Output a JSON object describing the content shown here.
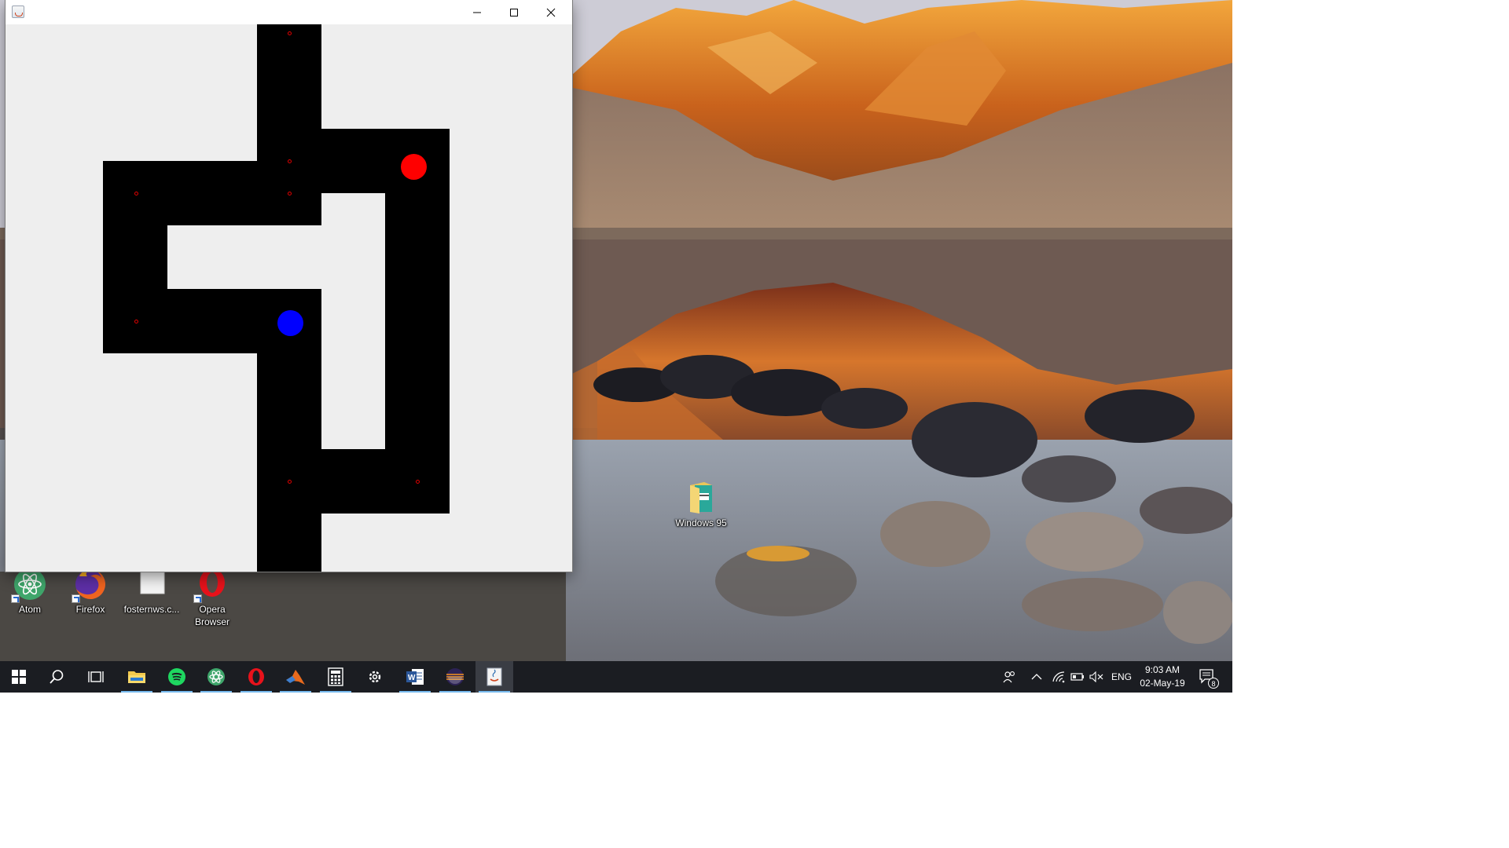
{
  "window": {
    "title": "",
    "icon": "java-icon",
    "controls": {
      "minimize": "minimize-icon",
      "maximize": "maximize-icon",
      "close": "close-icon"
    }
  },
  "maze": {
    "wall_color": "#000000",
    "floor_color": "#eeeeee",
    "waypoint_color": "#e00000",
    "player_color": "#0000ff",
    "enemy_color": "#ff0000"
  },
  "desktop_icons": [
    {
      "label": "Atom",
      "icon": "atom-icon"
    },
    {
      "label": "Firefox",
      "icon": "firefox-icon"
    },
    {
      "label": "fosternws.c...",
      "icon": "file-icon"
    },
    {
      "label": "Opera Browser",
      "icon": "opera-icon"
    },
    {
      "label": "Windows 95",
      "icon": "folder-icon"
    }
  ],
  "taskbar": {
    "items": [
      {
        "name": "start-button",
        "icon": "windows-logo-icon"
      },
      {
        "name": "search-button",
        "icon": "search-icon"
      },
      {
        "name": "task-view-button",
        "icon": "task-view-icon"
      },
      {
        "name": "file-explorer-button",
        "icon": "folder-icon"
      },
      {
        "name": "spotify-button",
        "icon": "spotify-icon"
      },
      {
        "name": "atom-button",
        "icon": "atom-icon"
      },
      {
        "name": "opera-button",
        "icon": "opera-icon"
      },
      {
        "name": "matlab-button",
        "icon": "matlab-icon"
      },
      {
        "name": "calculator-button",
        "icon": "calculator-icon"
      },
      {
        "name": "settings-button",
        "icon": "gear-icon"
      },
      {
        "name": "word-button",
        "icon": "word-icon"
      },
      {
        "name": "eclipse-button",
        "icon": "eclipse-icon"
      },
      {
        "name": "java-app-button",
        "icon": "java-icon"
      }
    ],
    "tray": {
      "language": "ENG",
      "time": "9:03 AM",
      "date": "02-May-19",
      "notification_count": "8"
    },
    "accent_color": "#76b9ed"
  }
}
